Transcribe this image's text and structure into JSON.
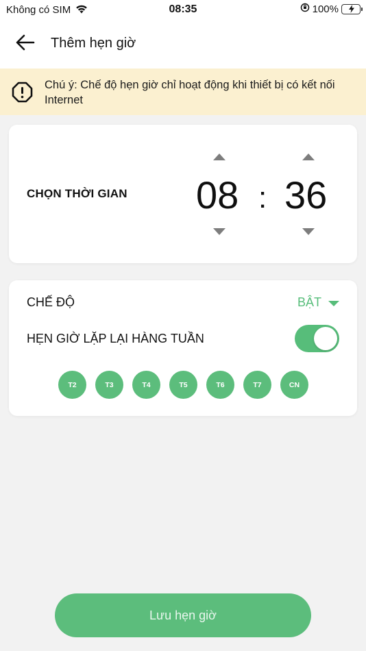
{
  "status_bar": {
    "carrier": "Không có SIM",
    "time": "08:35",
    "battery": "100%"
  },
  "header": {
    "title": "Thêm hẹn giờ"
  },
  "notice": {
    "text": "Chú ý: Chế độ hẹn giờ chỉ hoạt động khi thiết bị có kết nối Internet"
  },
  "time_picker": {
    "label": "CHỌN THỜI GIAN",
    "hour": "08",
    "separator": ":",
    "minute": "36"
  },
  "settings": {
    "mode_label": "CHẾ ĐỘ",
    "mode_value": "BẬT",
    "repeat_label": "HẸN GIỜ LẶP LẠI HÀNG TUẦN",
    "repeat_enabled": true,
    "days": [
      "T2",
      "T3",
      "T4",
      "T5",
      "T6",
      "T7",
      "CN"
    ]
  },
  "save_button": {
    "label": "Lưu hẹn giờ"
  },
  "colors": {
    "accent_green": "#5cbd7c",
    "notice_bg": "#fbf0d0",
    "page_bg": "#f2f2f2"
  },
  "icons": {
    "back": "arrow-left-icon",
    "notice": "alert-octagon-icon",
    "wifi": "wifi-icon",
    "battery": "battery-charging-icon",
    "orientation_lock": "orientation-lock-icon"
  }
}
